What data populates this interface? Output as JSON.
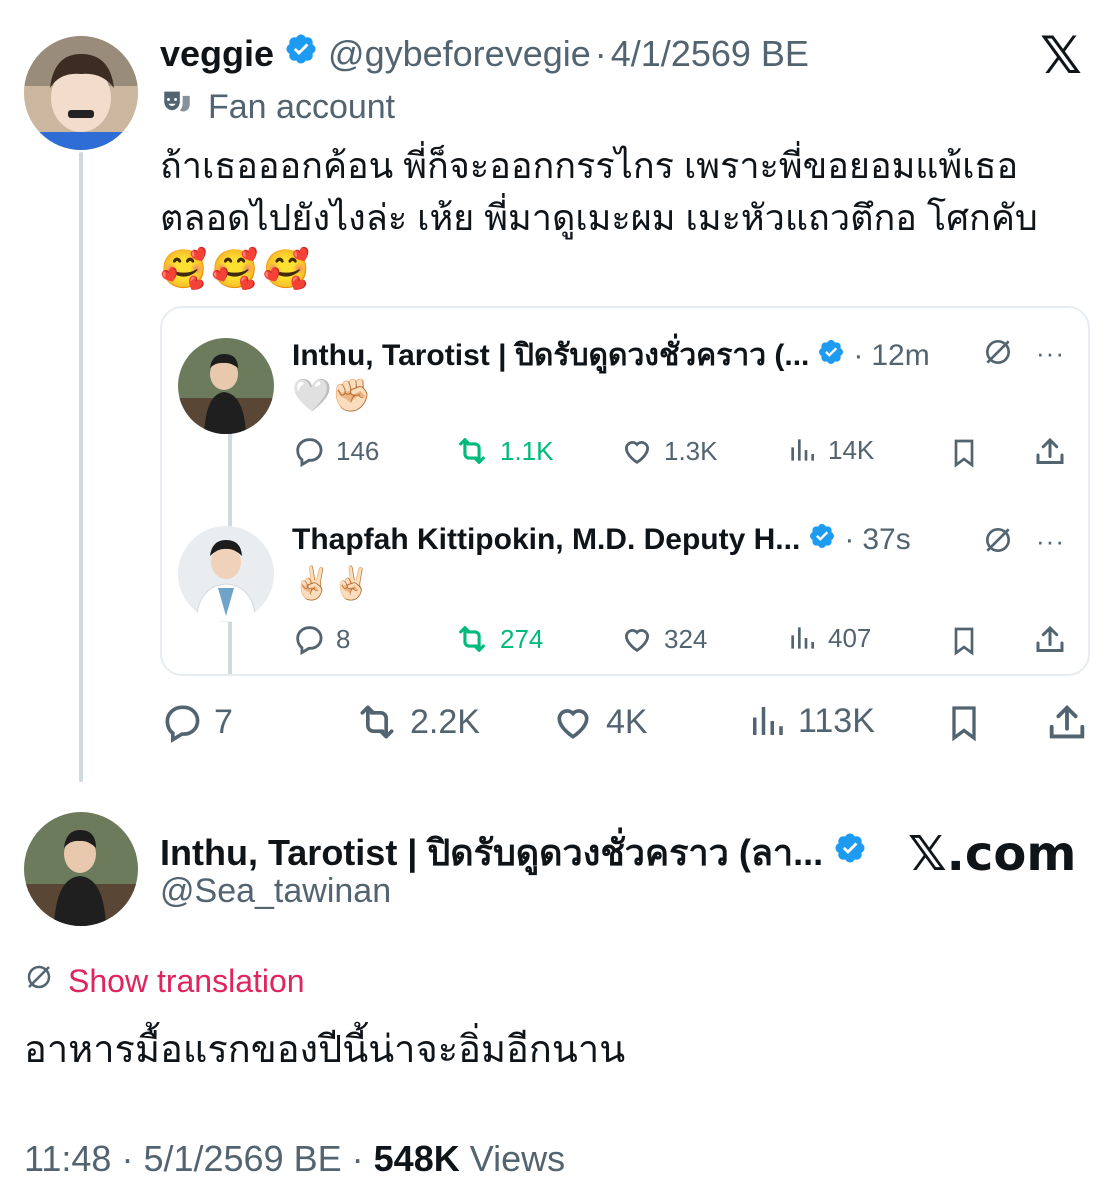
{
  "main_tweet": {
    "display_name": "veggie",
    "handle": "@gybeforevegie",
    "separator": "·",
    "date": "4/1/2569 BE",
    "account_label": "Fan account",
    "text_line1": "ถ้าเธอออกค้อน พี่ก็จะออกกรรไกร เพราะพี่ขอยอมแพ้เธอ",
    "text_line2": "ตลอดไปยังไงล่ะ เห้ย พี่มาดูเมะผม เมะหัวแถวตึกอ โศกคับ",
    "emojis": "🥰🥰🥰",
    "metrics": {
      "replies": "7",
      "reposts": "2.2K",
      "likes": "4K",
      "views": "113K"
    }
  },
  "quoted_thread": [
    {
      "display_name": "Inthu, Tarotist | ปิดรับดูดวงชั่วคราว (...",
      "separator": "·",
      "time": "12m",
      "text": "🤍✊🏻",
      "metrics": {
        "replies": "146",
        "reposts": "1.1K",
        "likes": "1.3K",
        "views": "14K"
      }
    },
    {
      "display_name": "Thapfah Kittipokin, M.D. Deputy H...",
      "separator": "·",
      "time": "37s",
      "text": "✌🏻✌🏻",
      "metrics": {
        "replies": "8",
        "reposts": "274",
        "likes": "324",
        "views": "407"
      }
    }
  ],
  "reply_tweet": {
    "display_name": "Inthu, Tarotist | ปิดรับดูดวงชั่วคราว (ลา...",
    "handle": "@Sea_tawinan",
    "brand": "𝕏.com",
    "translate_label": "Show translation",
    "text": "อาหารมื้อแรกของปีนี้น่าจะอิ่มอีกนาน",
    "time": "11:48",
    "separator": "·",
    "date": "5/1/2569 BE",
    "views_count": "548K",
    "views_label": "Views"
  },
  "x_logo": "𝕏",
  "colors": {
    "verified": "#1d9bf0",
    "repost_green": "#00ba7c",
    "translate_pink": "#e0245e",
    "gray": "#536471"
  }
}
